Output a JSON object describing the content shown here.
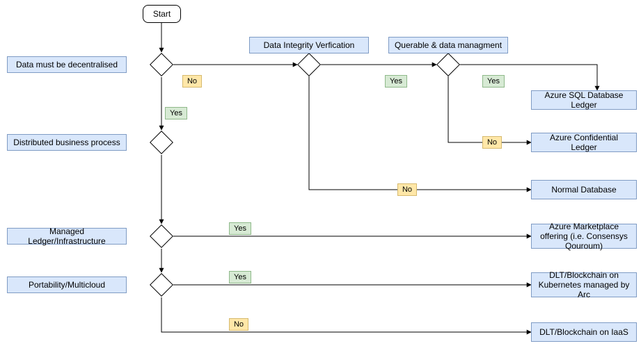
{
  "chart_data": {
    "type": "flowchart",
    "start": "Start",
    "decisions": [
      {
        "id": "d1",
        "label": "Data must be decentralised",
        "yes": "d2",
        "no": "d_div"
      },
      {
        "id": "d_div",
        "label": "Data Integrity Verfication",
        "yes": "d_query",
        "no": "out_normaldb"
      },
      {
        "id": "d_query",
        "label": "Querable & data managment",
        "yes": "out_sqlledger",
        "no": "out_confledger"
      },
      {
        "id": "d2",
        "label": "Distributed business process",
        "next": "d3"
      },
      {
        "id": "d3",
        "label": "Managed Ledger/Infrastructure",
        "yes": "out_marketplace",
        "next": "d4"
      },
      {
        "id": "d4",
        "label": "Portability/Multicloud",
        "yes": "out_kube",
        "no": "out_iaas"
      }
    ],
    "outcomes": {
      "out_sqlledger": "Azure SQL Database Ledger",
      "out_confledger": "Azure Confidential Ledger",
      "out_normaldb": "Normal Database",
      "out_marketplace": "Azure Marketplace offering (i.e. Consensys Qouroum)",
      "out_kube": "DLT/Blockchain on Kubernetes managed by Arc",
      "out_iaas": "DLT/Blockchain on IaaS"
    }
  },
  "nodes": {
    "start": "Start",
    "q_decentral": "Data must be decentralised",
    "q_distributed": "Distributed business process",
    "q_managed": "Managed Ledger/Infrastructure",
    "q_portability": "Portability/Multicloud",
    "q_div": "Data Integrity Verfication",
    "q_query": "Querable & data managment",
    "out_sqlledger": "Azure SQL Database Ledger",
    "out_confledger": "Azure Confidential Ledger",
    "out_normaldb": "Normal Database",
    "out_marketplace": "Azure Marketplace offering (i.e. Consensys Qouroum)",
    "out_kube": "DLT/Blockchain on Kubernetes managed by Arc",
    "out_iaas": "DLT/Blockchain on IaaS"
  },
  "labels": {
    "yes": "Yes",
    "no": "No"
  }
}
